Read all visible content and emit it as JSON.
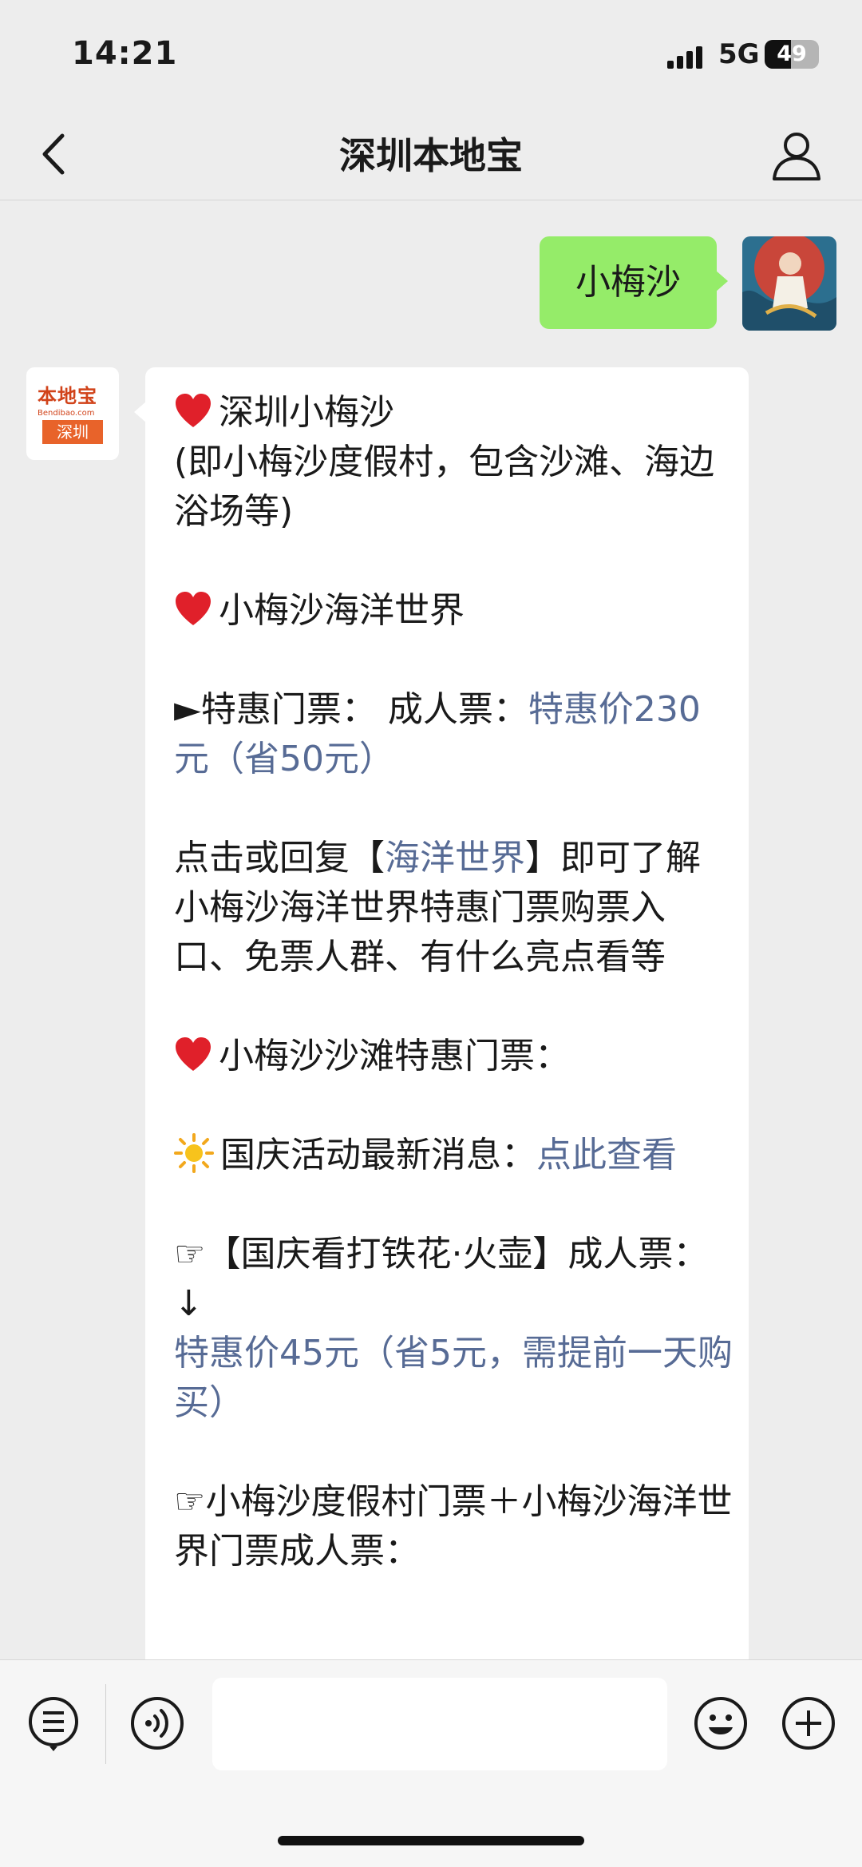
{
  "status_bar": {
    "time": "14:21",
    "network": "5G",
    "battery": "49",
    "battery_level": 0.49
  },
  "header": {
    "title": "深圳本地宝",
    "back_icon": "chevron-left-icon",
    "profile_icon": "person-icon"
  },
  "user_message": {
    "text": "小梅沙"
  },
  "bot": {
    "logo_text": "本地宝",
    "logo_url": "Bendibao.com",
    "logo_city": "深圳"
  },
  "bot_message": {
    "sec1_title": "深圳小梅沙",
    "sec1_body": "(即小梅沙度假村，包含沙滩、海边浴场等)",
    "sec2_title": "小梅沙海洋世界",
    "ticket1_label": "►特惠门票： 成人票：",
    "ticket1_price": "特惠价230元（省50元）",
    "reply_pre": "点击或回复【",
    "reply_kw": "海洋世界",
    "reply_post": "】即可了解小梅沙海洋世界特惠门票购票入口、免票人群、有什么亮点看等",
    "sec3_title": "小梅沙沙滩特惠门票：",
    "news_label": "国庆活动最新消息：",
    "news_link": "点此查看",
    "ticket2_label": "☞【国庆看打铁花·火壶】成人票：↓",
    "ticket2_price": "特惠价45元（省5元，需提前一天购买）",
    "ticket3_label": "☞小梅沙度假村门票＋小梅沙海洋世界门票成人票："
  },
  "colors": {
    "link": "#576b95",
    "user_bubble": "#95ec69",
    "background": "#ededed"
  },
  "bottom_bar": {
    "menu_icon": "menu-list-icon",
    "voice_icon": "voice-icon",
    "emoji_icon": "emoji-icon",
    "plus_icon": "plus-icon",
    "input_value": ""
  }
}
